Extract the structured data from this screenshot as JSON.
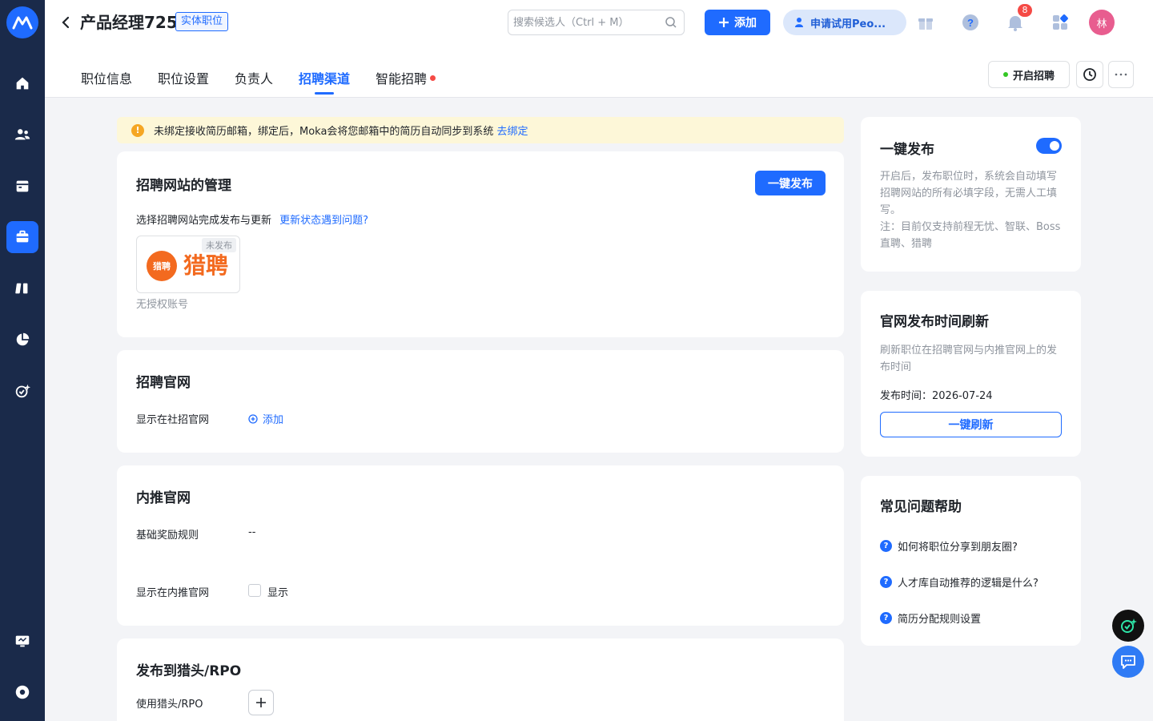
{
  "header": {
    "title": "产品经理725",
    "tag": "实体职位",
    "search_placeholder": "搜索候选人（Ctrl + M）",
    "add_label": "添加",
    "trial_label": "申请试用Peo...",
    "notification_count": "8",
    "avatar_text": "林"
  },
  "tabs": [
    {
      "label": "职位信息"
    },
    {
      "label": "职位设置"
    },
    {
      "label": "负责人"
    },
    {
      "label": "招聘渠道"
    },
    {
      "label": "智能招聘"
    }
  ],
  "tab_actions": {
    "start_label": "开启招聘"
  },
  "alert": {
    "text": "未绑定接收简历邮箱，绑定后，Moka会将您邮箱中的简历自动同步到系统",
    "link": "去绑定"
  },
  "site_mgmt": {
    "title": "招聘网站的管理",
    "publish_btn": "一键发布",
    "desc": "选择招聘网站完成发布与更新",
    "help_link": "更新状态遇到问题?",
    "site_logo_text": "猎聘",
    "site_logo_inner": "猎聘",
    "site_status": "未发布",
    "site_account": "无授权账号"
  },
  "official_site": {
    "title": "招聘官网",
    "label": "显示在社招官网",
    "add": "添加"
  },
  "referral_site": {
    "title": "内推官网",
    "rule_label": "基础奖励规则",
    "rule_value": "--",
    "show_label": "显示在内推官网",
    "show_option": "显示"
  },
  "headhunter": {
    "title": "发布到猎头/RPO",
    "label": "使用猎头/RPO"
  },
  "one_click": {
    "title": "一键发布",
    "desc": "开启后，发布职位时，系统会自动填写招聘网站的所有必填字段，无需人工填写。",
    "note": "注：目前仅支持前程无忧、智联、Boss直聘、猎聘"
  },
  "refresh": {
    "title": "官网发布时间刷新",
    "desc": "刷新职位在招聘官网与内推官网上的发布时间",
    "time_label": "发布时间：2026-07-24",
    "btn": "一键刷新"
  },
  "faq": {
    "title": "常见问题帮助",
    "items": [
      {
        "q": "如何将职位分享到朋友圈?"
      },
      {
        "q": "人才库自动推荐的逻辑是什么?"
      },
      {
        "q": "简历分配规则设置"
      }
    ]
  }
}
